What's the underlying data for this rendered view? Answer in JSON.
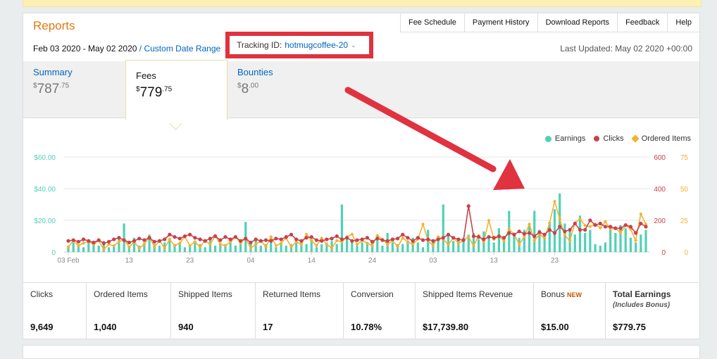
{
  "header": {
    "title": "Reports",
    "tabs": [
      "Fee Schedule",
      "Payment History",
      "Download Reports",
      "Feedback",
      "Help"
    ],
    "date_range": "Feb 03 2020 - May 02 2020",
    "custom_range_label": "Custom Date Range",
    "tracking_label": "Tracking ID:",
    "tracking_value": "hotmugcoffee-20",
    "last_updated": "Last Updated: May 02 2020 +00:00"
  },
  "summary_tabs": [
    {
      "name": "Summary",
      "dollar": "$",
      "whole": "787",
      "cents": ".75"
    },
    {
      "name": "Fees",
      "dollar": "$",
      "whole": "779",
      "cents": ".75"
    },
    {
      "name": "Bounties",
      "dollar": "$",
      "whole": "8",
      "cents": ".00"
    }
  ],
  "colors": {
    "earnings": "#4fd1b5",
    "clicks": "#c8424b",
    "ordered": "#f2b134",
    "arrow": "#e0323f",
    "accent": "#e47911",
    "link": "#0066c0"
  },
  "legend": {
    "earnings": "Earnings",
    "clicks": "Clicks",
    "ordered": "Ordered Items"
  },
  "chart_data": {
    "type": "line",
    "x_ticks": [
      "03 Feb",
      "13",
      "23",
      "04",
      "14",
      "24",
      "03",
      "13",
      "23"
    ],
    "y_left_ticks": [
      "0",
      "$20.00",
      "$40.00",
      "$60.00"
    ],
    "y_left_max": 60,
    "y_right_ticks": [
      {
        "clicks": "0",
        "ordered": "0"
      },
      {
        "clicks": "200",
        "ordered": "25"
      },
      {
        "clicks": "400",
        "ordered": "50"
      },
      {
        "clicks": "600",
        "ordered": "75"
      }
    ],
    "y_right_clicks_max": 600,
    "y_right_ordered_max": 75,
    "series": [
      {
        "name": "Earnings",
        "type": "bar",
        "values": [
          4,
          6,
          5,
          3,
          6,
          5,
          4,
          7,
          3,
          4,
          8,
          18,
          4,
          9,
          4,
          6,
          11,
          5,
          4,
          6,
          9,
          5,
          6,
          3,
          4,
          7,
          5,
          3,
          8,
          4,
          6,
          5,
          9,
          4,
          6,
          19,
          5,
          8,
          4,
          5,
          10,
          3,
          6,
          4,
          5,
          6,
          7,
          5,
          8,
          3,
          5,
          6,
          7,
          5,
          30,
          9,
          7,
          4,
          6,
          5,
          7,
          8,
          4,
          12,
          6,
          5,
          5,
          7,
          9,
          6,
          3,
          14,
          6,
          8,
          30,
          10,
          7,
          8,
          9,
          11,
          12,
          8,
          13,
          10,
          6,
          15,
          9,
          26,
          11,
          9,
          14,
          18,
          26,
          14,
          12,
          19,
          27,
          37,
          18,
          15,
          11,
          23,
          12,
          14,
          5,
          4,
          6,
          15,
          12,
          17,
          15,
          9,
          6,
          11,
          14
        ],
        "color": "#4fd1b5"
      },
      {
        "name": "Clicks",
        "type": "line",
        "values": [
          70,
          75,
          65,
          80,
          70,
          60,
          75,
          55,
          65,
          80,
          90,
          75,
          60,
          70,
          85,
          75,
          90,
          65,
          70,
          80,
          110,
          95,
          85,
          100,
          110,
          90,
          80,
          70,
          85,
          100,
          75,
          95,
          80,
          95,
          70,
          85,
          60,
          80,
          70,
          75,
          70,
          85,
          80,
          95,
          110,
          80,
          70,
          90,
          95,
          75,
          70,
          80,
          85,
          100,
          80,
          90,
          70,
          75,
          80,
          90,
          65,
          85,
          75,
          70,
          80,
          85,
          110,
          90,
          70,
          90,
          75,
          80,
          70,
          80,
          90,
          110,
          90,
          80,
          75,
          290,
          100,
          95,
          80,
          95,
          90,
          100,
          90,
          120,
          110,
          130,
          115,
          120,
          100,
          125,
          110,
          140,
          120,
          160,
          130,
          140,
          180,
          140,
          140,
          200,
          170,
          180,
          160,
          160,
          150,
          150,
          170,
          160,
          120,
          180,
          160
        ],
        "color": "#c8424b"
      },
      {
        "name": "Ordered Items",
        "type": "line",
        "values": [
          4,
          9,
          5,
          7,
          8,
          6,
          9,
          2,
          6,
          5,
          8,
          10,
          4,
          8,
          3,
          6,
          12,
          4,
          9,
          3,
          10,
          5,
          7,
          12,
          5,
          8,
          4,
          9,
          6,
          13,
          6,
          5,
          8,
          12,
          7,
          11,
          3,
          6,
          9,
          4,
          12,
          5,
          7,
          11,
          4,
          8,
          6,
          14,
          9,
          5,
          11,
          6,
          3,
          9,
          8,
          12,
          14,
          6,
          9,
          7,
          5,
          13,
          10,
          6,
          9,
          4,
          11,
          8,
          6,
          10,
          22,
          9,
          5,
          12,
          10,
          6,
          11,
          7,
          9,
          12,
          5,
          13,
          8,
          25,
          10,
          12,
          9,
          18,
          14,
          6,
          12,
          22,
          9,
          14,
          11,
          23,
          40,
          26,
          13,
          9,
          23,
          26,
          21,
          20,
          22,
          19,
          24,
          18,
          19,
          15,
          21,
          18,
          9,
          30,
          22
        ],
        "color": "#f2b134"
      }
    ]
  },
  "stats": [
    {
      "label": "Clicks",
      "value": "9,649"
    },
    {
      "label": "Ordered Items",
      "value": "1,040"
    },
    {
      "label": "Shipped Items",
      "value": "940"
    },
    {
      "label": "Returned Items",
      "value": "17"
    },
    {
      "label": "Conversion",
      "value": "10.78%"
    },
    {
      "label": "Shipped Items Revenue",
      "value": "$17,739.80"
    },
    {
      "label": "Bonus",
      "badge": "NEW",
      "value": "$15.00"
    },
    {
      "label": "Total Earnings",
      "sub": "(Includes Bonus)",
      "value": "$779.75"
    }
  ]
}
